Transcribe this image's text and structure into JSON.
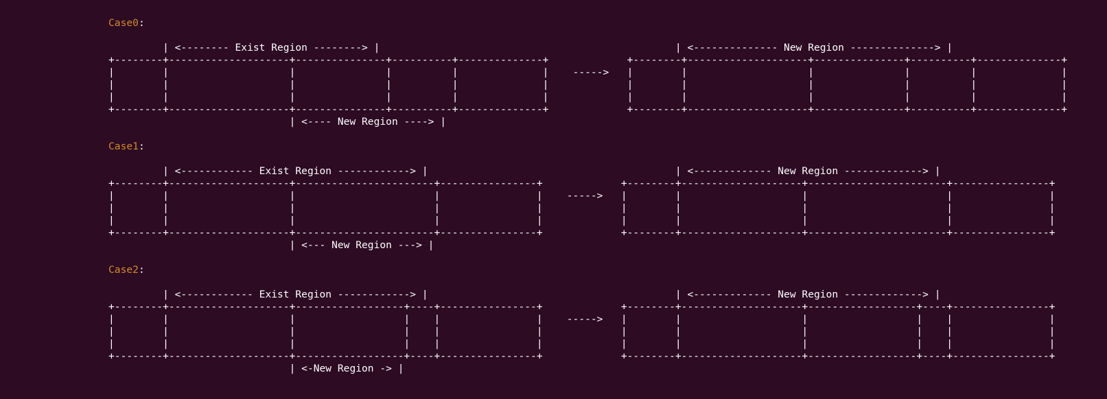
{
  "colors": {
    "background": "#2c0b23",
    "text": "#ffffff",
    "case_label": "#d38b2b"
  },
  "cases": [
    {
      "label": "Case0",
      "colon": ":",
      "lines": [
        "",
        "         | <-------- Exist Region --------> |                                                 | <-------------- New Region --------------> |",
        "+--------+--------------------+---------------+----------+--------------+             +--------+--------------------+---------------+----------+--------------+",
        "|        |                    |               |          |              |    ----->   |        |                    |               |          |              |",
        "|        |                    |               |          |              |             |        |                    |               |          |              |",
        "|        |                    |               |          |              |             |        |                    |               |          |              |",
        "+--------+--------------------+---------------+----------+--------------+             +--------+--------------------+---------------+----------+--------------+",
        "                              | <---- New Region ----> |"
      ]
    },
    {
      "label": "Case1",
      "colon": ":",
      "lines": [
        "",
        "         | <------------ Exist Region ------------> |                                         | <------------- New Region -------------> |",
        "+--------+--------------------+-----------------------+----------------+             +--------+--------------------+-----------------------+----------------+",
        "|        |                    |                       |                |    ----->   |        |                    |                       |                |",
        "|        |                    |                       |                |             |        |                    |                       |                |",
        "|        |                    |                       |                |             |        |                    |                       |                |",
        "+--------+--------------------+-----------------------+----------------+             +--------+--------------------+-----------------------+----------------+",
        "                              | <--- New Region ---> |"
      ]
    },
    {
      "label": "Case2",
      "colon": ":",
      "lines": [
        "",
        "         | <------------ Exist Region ------------> |                                         | <------------- New Region -------------> |",
        "+--------+--------------------+------------------+----+----------------+             +--------+--------------------+------------------+----+----------------+",
        "|        |                    |                  |    |                |    ----->   |        |                    |                  |    |                |",
        "|        |                    |                  |    |                |             |        |                    |                  |    |                |",
        "|        |                    |                  |    |                |             |        |                    |                  |    |                |",
        "+--------+--------------------+------------------+----+----------------+             +--------+--------------------+------------------+----+----------------+",
        "                              | <-New Region -> |"
      ]
    }
  ]
}
